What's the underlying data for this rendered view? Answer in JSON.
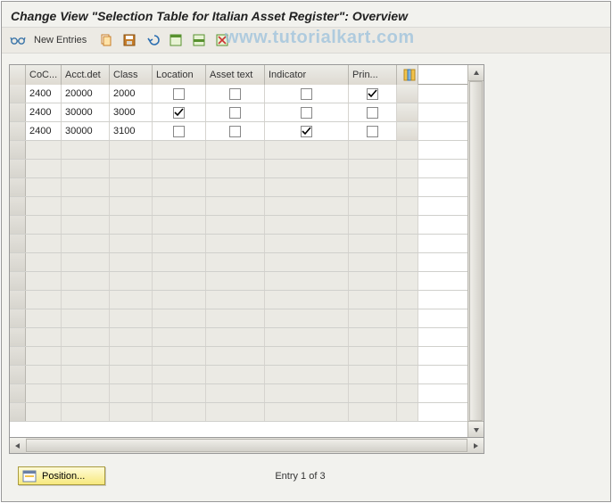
{
  "title": "Change View \"Selection Table for Italian Asset Register\": Overview",
  "toolbar": {
    "new_entries": "New Entries"
  },
  "watermark": "www.tutorialkart.com",
  "columns": {
    "coc": "CoC...",
    "acct": "Acct.det",
    "class": "Class",
    "location": "Location",
    "asset_text": "Asset text",
    "indicator": "Indicator",
    "prin": "Prin..."
  },
  "rows": [
    {
      "coc": "2400",
      "acct": "20000",
      "class": "2000",
      "location": false,
      "asset_text": false,
      "indicator": false,
      "prin": true
    },
    {
      "coc": "2400",
      "acct": "30000",
      "class": "3000",
      "location": true,
      "asset_text": false,
      "indicator": false,
      "prin": false
    },
    {
      "coc": "2400",
      "acct": "30000",
      "class": "3100",
      "location": false,
      "asset_text": false,
      "indicator": true,
      "prin": false
    }
  ],
  "empty_row_count": 15,
  "footer": {
    "position_label": "Position...",
    "entry_text": "Entry 1 of 3"
  }
}
